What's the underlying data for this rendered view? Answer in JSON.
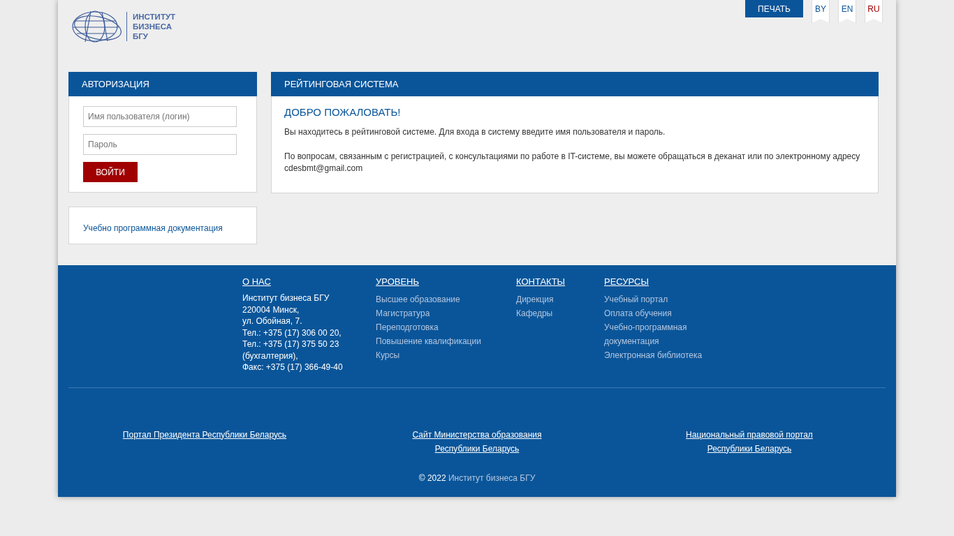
{
  "header": {
    "logo_text": [
      "ИНСТИТУТ",
      "БИЗНЕСА",
      "БГУ"
    ],
    "print_button": "ПЕЧАТЬ",
    "languages": [
      {
        "label": "BY",
        "selected": false
      },
      {
        "label": "EN",
        "selected": false
      },
      {
        "label": "RU",
        "selected": true
      }
    ]
  },
  "login": {
    "title": "АВТОРИЗАЦИЯ",
    "username": {
      "placeholder": "Имя пользователя (логин)"
    },
    "password": {
      "placeholder": "Пароль"
    },
    "submit": "ВОЙТИ"
  },
  "docs_link": "Учебно программная документация",
  "main": {
    "title": "РЕЙТИНГОВАЯ СИСТЕМА",
    "heading": "ДОБРО ПОЖАЛОВАТЬ!",
    "paragraphs": [
      "Вы находитесь в рейтинговой системе. Для входа в систему введите имя пользователя и пароль.",
      "По вопросам, связанным с регистрацией, с консультациями по работе в IT-системе, вы можете обращаться в деканат или по электронному адресу cdesbmt@gmail.com"
    ]
  },
  "footer": {
    "about": {
      "title": "О НАС",
      "lines": [
        "Институт бизнеса БГУ",
        "220004 Минск,",
        "ул. Обойная, 7.",
        "Тел.: +375 (17) 306 00 20,",
        "Тел.: +375 (17) 375 50 23",
        "(бухгалтерия),",
        "Факс: +375 (17) 366-49-40"
      ]
    },
    "columns": [
      {
        "title": "УРОВЕНЬ",
        "links": [
          "Высшее образование",
          "Магистратура",
          "Переподготовка",
          "Повышение квалификации",
          "Курсы"
        ]
      },
      {
        "title": "КОНТАКТЫ",
        "links": [
          "Дирекция",
          "Кафедры"
        ]
      },
      {
        "title": "РЕСУРСЫ",
        "links": [
          "Учебный портал",
          "Оплата обучения",
          "Учебно-программная документация",
          "Электронная библиотека"
        ]
      }
    ],
    "portals": [
      [
        "Портал Президента Республики Беларусь"
      ],
      [
        "Сайт Министерства образования",
        "Республики Беларусь"
      ],
      [
        "Национальный правовой портал",
        "Республики Беларусь"
      ]
    ],
    "copyright": "© 2022",
    "copyright_link": "Институт бизнеса БГУ"
  }
}
